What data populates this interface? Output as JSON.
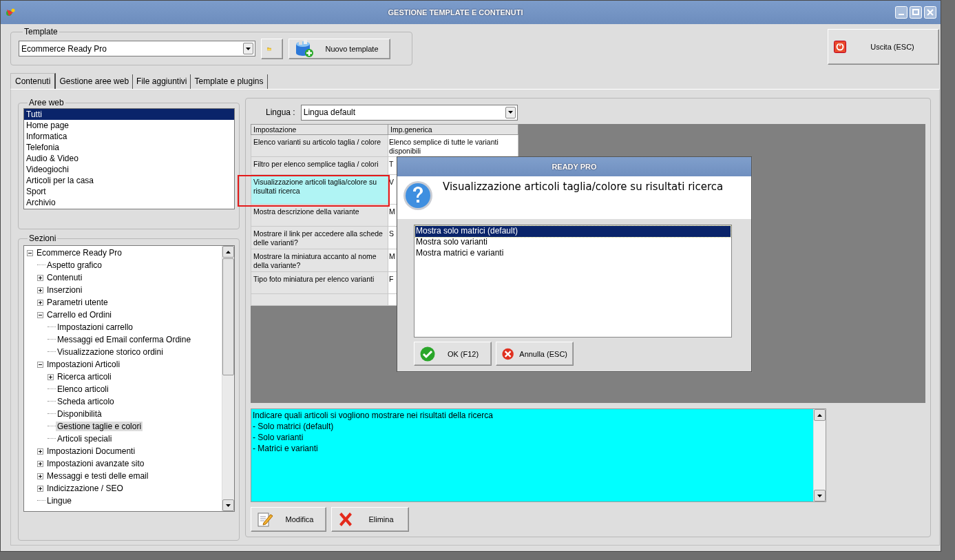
{
  "window": {
    "title": "GESTIONE TEMPLATE E CONTENUTI"
  },
  "template_group": {
    "label": "Template",
    "value": "Ecommerce Ready Pro",
    "new_button": "Nuovo template"
  },
  "exit_button": "Uscita (ESC)",
  "tabs": [
    {
      "label": "Contenuti",
      "selected": true
    },
    {
      "label": "Gestione aree web",
      "selected": false
    },
    {
      "label": "File aggiuntivi",
      "selected": false
    },
    {
      "label": "Template e plugins",
      "selected": false
    }
  ],
  "web_areas": {
    "label": "Aree web",
    "items": [
      {
        "label": "Tutti",
        "selected": true
      },
      {
        "label": "Home page",
        "selected": false
      },
      {
        "label": "Informatica",
        "selected": false
      },
      {
        "label": "Telefonia",
        "selected": false
      },
      {
        "label": "Audio & Video",
        "selected": false
      },
      {
        "label": "Videogiochi",
        "selected": false
      },
      {
        "label": "Articoli per la casa",
        "selected": false
      },
      {
        "label": "Sport",
        "selected": false
      },
      {
        "label": "Archivio",
        "selected": false
      }
    ]
  },
  "sections": {
    "label": "Sezioni",
    "tree": [
      {
        "label": "Ecommerce Ready Pro",
        "expanded": true,
        "selected": false,
        "children": [
          {
            "label": "Aspetto grafico",
            "selected": false
          },
          {
            "label": "Contenuti",
            "expanded": false,
            "selected": false
          },
          {
            "label": "Inserzioni",
            "expanded": false,
            "selected": false
          },
          {
            "label": "Parametri utente",
            "expanded": false,
            "selected": false
          },
          {
            "label": "Carrello ed Ordini",
            "expanded": true,
            "selected": false,
            "children": [
              {
                "label": "Impostazioni carrello",
                "selected": false
              },
              {
                "label": "Messaggi ed Email conferma Ordine",
                "selected": false
              },
              {
                "label": "Visualizzazione storico ordini",
                "selected": false
              }
            ]
          },
          {
            "label": "Impostazioni Articoli",
            "expanded": true,
            "selected": false,
            "children": [
              {
                "label": "Ricerca articoli",
                "expanded": false,
                "selected": false
              },
              {
                "label": "Elenco articoli",
                "selected": false
              },
              {
                "label": "Scheda articolo",
                "selected": false
              },
              {
                "label": "Disponibilità",
                "selected": false
              },
              {
                "label": "Gestione taglie e colori",
                "selected": true
              },
              {
                "label": "Articoli speciali",
                "selected": false
              }
            ]
          },
          {
            "label": "Impostazioni Documenti",
            "expanded": false,
            "selected": false
          },
          {
            "label": "Impostazioni avanzate sito",
            "expanded": false,
            "selected": false
          },
          {
            "label": "Messaggi e testi delle email",
            "expanded": false,
            "selected": false
          },
          {
            "label": "Indicizzazione / SEO",
            "expanded": false,
            "selected": false
          },
          {
            "label": "Lingue",
            "selected": false
          }
        ]
      }
    ]
  },
  "language": {
    "label": "Lingua :",
    "value": "Lingua default"
  },
  "settings_table": {
    "columns": [
      "Impostazione",
      "Imp.generica"
    ],
    "rows": [
      {
        "cells": [
          "Elenco varianti su articolo taglia / colore",
          "Elenco semplice di tutte le varianti disponibili"
        ],
        "selected": false
      },
      {
        "cells": [
          "Filtro per elenco semplice taglia / colori",
          "T"
        ],
        "selected": false
      },
      {
        "cells": [
          "Visualizzazione articoli taglia/colore su risultati ricerca",
          "V"
        ],
        "selected": true
      },
      {
        "cells": [
          "Mostra descrizione della variante",
          "M"
        ],
        "selected": false
      },
      {
        "cells": [
          "Mostrare il link per accedere alla schede delle varianti?",
          "S"
        ],
        "selected": false
      },
      {
        "cells": [
          "Mostrare la miniatura accanto al nome della variante?",
          "M"
        ],
        "selected": false
      },
      {
        "cells": [
          "Tipo foto miniatura per elenco varianti",
          "F"
        ],
        "selected": false
      }
    ]
  },
  "description": "Indicare quali articoli si vogliono mostrare nei risultati della ricerca\n- Solo matrici (default)\n- Solo varianti\n- Matrici e varianti",
  "buttons": [
    "Modifica",
    "Elimina"
  ],
  "dialog": {
    "title": "READY PRO",
    "question": "Visualizzazione articoli taglia/colore su risultati ricerca",
    "options": [
      {
        "label": "Mostra solo matrici (default)",
        "selected": true
      },
      {
        "label": "Mostra solo varianti",
        "selected": false
      },
      {
        "label": "Mostra matrici e varianti",
        "selected": false
      }
    ],
    "buttons": [
      "OK (F12)",
      "Annulla (ESC)"
    ]
  }
}
